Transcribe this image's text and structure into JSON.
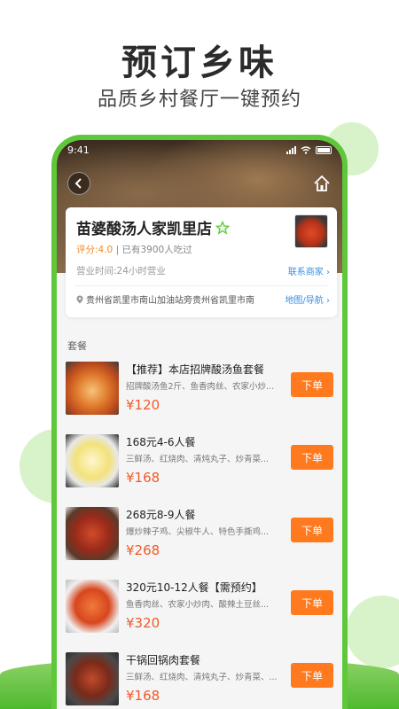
{
  "promo": {
    "title": "预订乡味",
    "subtitle": "品质乡村餐厅一键预约"
  },
  "status_bar": {
    "time": "9:41"
  },
  "shop": {
    "name": "苗婆酸汤人家凯里店",
    "rating": "评分:4.0",
    "diners": "已有3900人吃过",
    "hours": "营业时间:24小时营业",
    "contact_label": "联系商家",
    "address": "贵州省凯里市南山加油站旁贵州省凯里市南",
    "map_label": "地图/导航"
  },
  "menu": {
    "section_title": "套餐",
    "order_label": "下单",
    "items": [
      {
        "title": "【推荐】本店招牌酸汤鱼套餐",
        "desc": "招牌酸汤鱼2斤、鱼香肉丝、农家小炒...",
        "price": "¥120"
      },
      {
        "title": "168元4-6人餐",
        "desc": "三鲜汤、红烧肉、清炖丸子、炒青菜...",
        "price": "¥168"
      },
      {
        "title": "268元8-9人餐",
        "desc": "爆炒辣子鸡、尖椒牛人、特色手撕鸡...",
        "price": "¥268"
      },
      {
        "title": "320元10-12人餐【需预约】",
        "desc": "鱼香肉丝、农家小炒肉、酸辣土豆丝...",
        "price": "¥320"
      },
      {
        "title": "干锅回锅肉套餐",
        "desc": "三鲜汤、红烧肉、清炖丸子、炒青菜、...",
        "price": "¥168"
      }
    ]
  },
  "colors": {
    "brand_green": "#5fc83a",
    "accent_orange": "#ff7a1e",
    "price_red": "#f05a2a",
    "link_blue": "#3a8ee6"
  }
}
